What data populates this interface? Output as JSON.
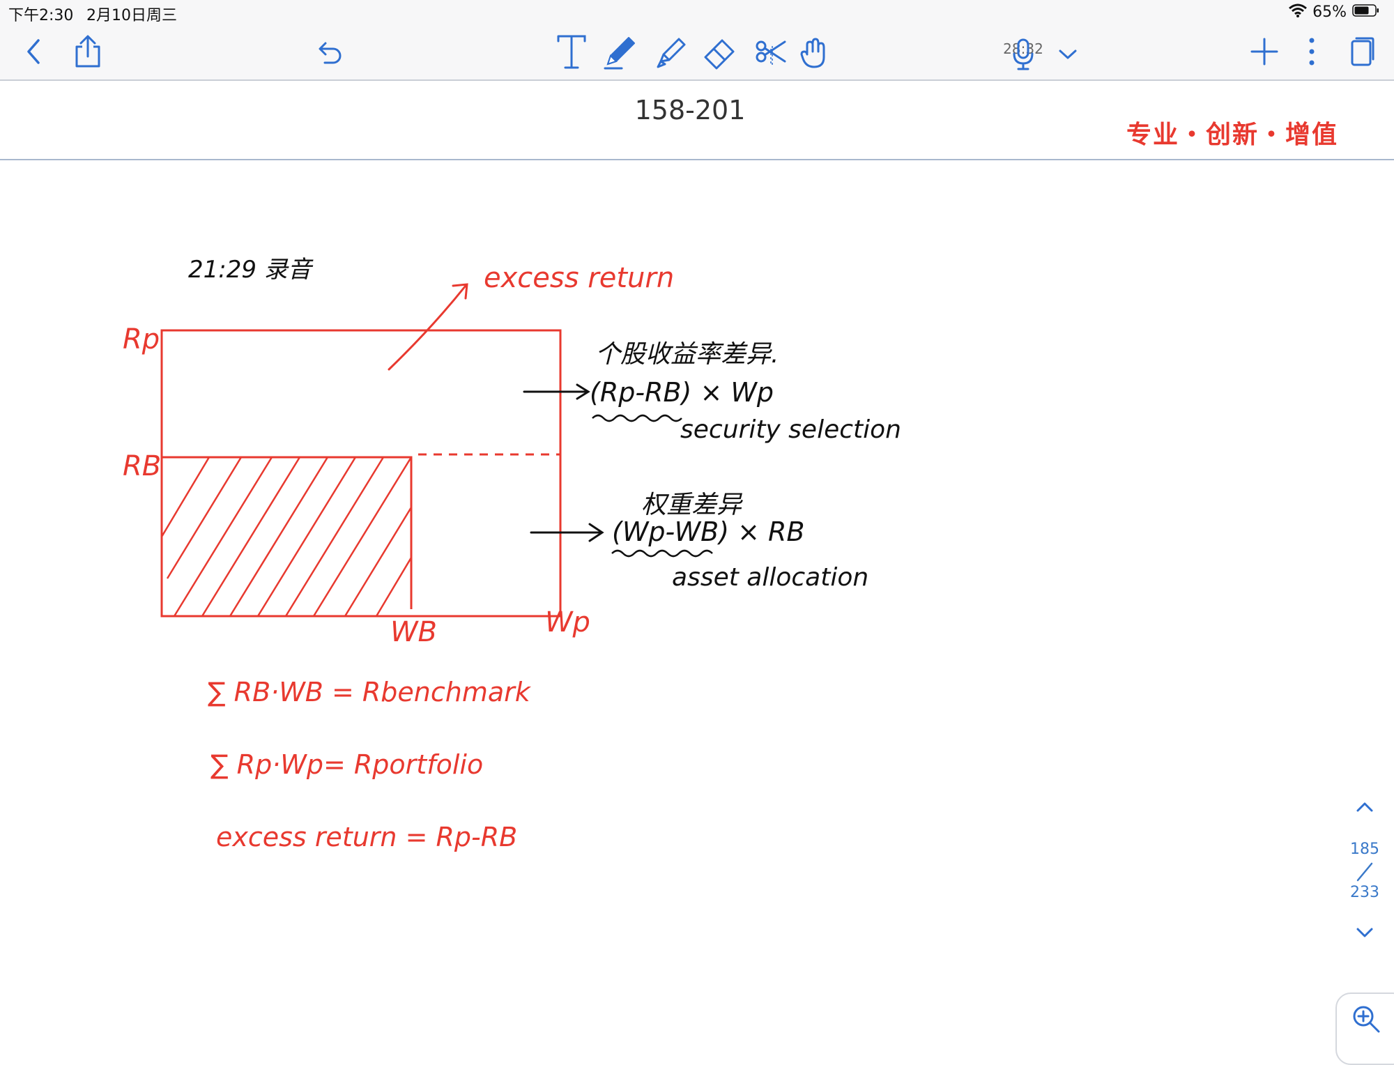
{
  "status_bar": {
    "time": "下午2:30",
    "date": "2月10日周三",
    "battery": "65%"
  },
  "toolbar": {
    "recording_time": "28:32",
    "icons": [
      "back-icon",
      "share-icon",
      "undo-icon",
      "text-tool-icon",
      "pen-icon",
      "highlighter-icon",
      "eraser-icon",
      "lasso-icon",
      "hand-icon",
      "microphone-icon",
      "chevron-down-icon",
      "add-page-icon",
      "more-icon",
      "pages-icon"
    ]
  },
  "page": {
    "title": "158-201",
    "brand": "专业・创新・增值"
  },
  "notes": {
    "timestamp": "21:29 录音",
    "excess_return_label": "excess return",
    "rp": "Rp",
    "rb": "RB",
    "wb": "WB",
    "wp": "Wp",
    "stock_diff_cn": "个股收益率差异.",
    "formula_security": "(Rp-RB) × Wp",
    "security_selection": "security selection",
    "weight_diff_cn": "权重差异",
    "formula_allocation": "(Wp-WB) × RB",
    "asset_allocation": "asset allocation",
    "eq_benchmark": "∑ RB·WB = Rbenchmark",
    "eq_portfolio": "∑ Rp·Wp= Rportfolio",
    "eq_excess": "excess return = Rp-RB"
  },
  "pager": {
    "current": "185",
    "total": "233"
  },
  "colors": {
    "ink_red": "#e8392f",
    "ink_black": "#111111",
    "accent_blue": "#3a79c9"
  }
}
